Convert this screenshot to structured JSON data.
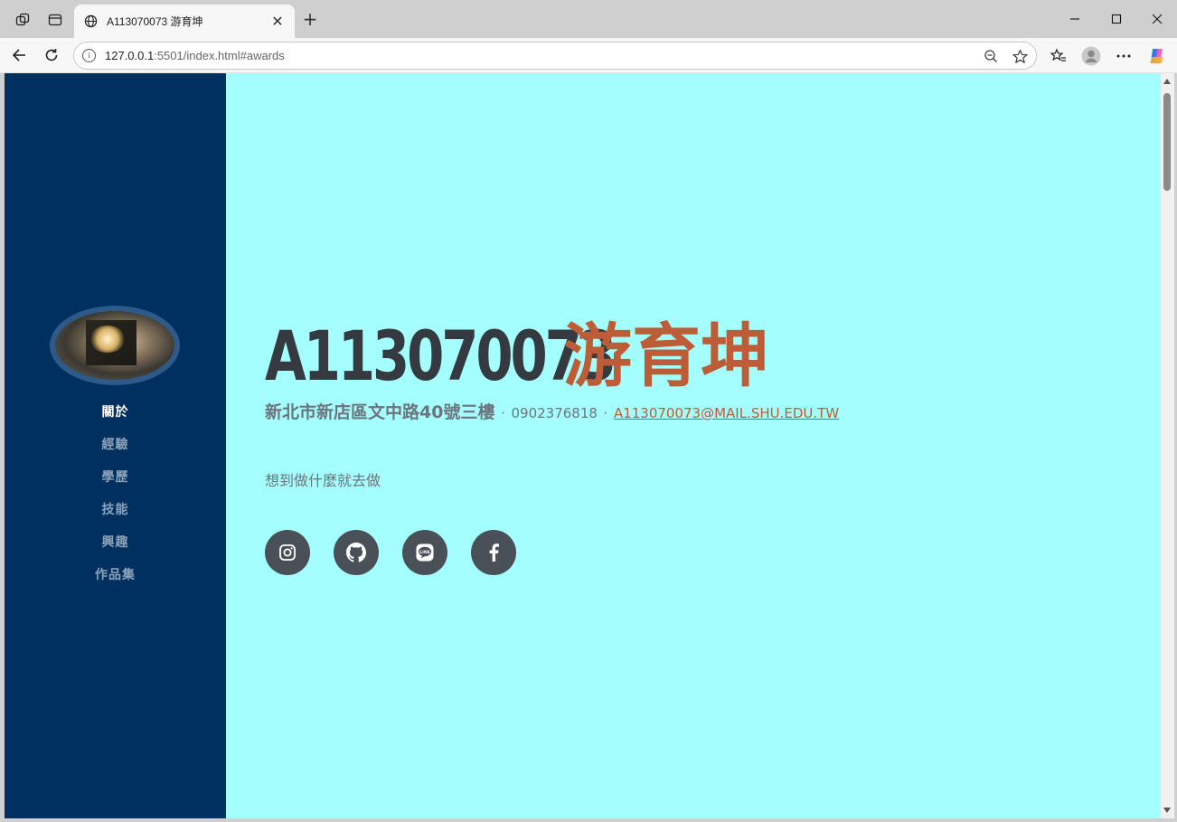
{
  "browser": {
    "tab_title": "A113070073 游育坤",
    "url_host": "127.0.0.1",
    "url_rest": ":5501/index.html#awards"
  },
  "sidebar": {
    "items": [
      {
        "label": "關於"
      },
      {
        "label": "經驗"
      },
      {
        "label": "學歷"
      },
      {
        "label": "技能"
      },
      {
        "label": "興趣"
      },
      {
        "label": "作品集"
      }
    ]
  },
  "profile": {
    "id_number": "A113070073",
    "name": "游育坤",
    "address": "新北市新店區文中路40號三樓",
    "separator": "·",
    "phone": "0902376818",
    "email": "A113070073@MAIL.SHU.EDU.TW",
    "motto": "想到做什麼就去做"
  },
  "social": {
    "icons": [
      "instagram-icon",
      "github-icon",
      "line-icon",
      "facebook-icon"
    ]
  },
  "colors": {
    "sidebar_bg": "#003060",
    "page_bg": "#a5fefe",
    "accent": "#bd5d38",
    "heading": "#343a40",
    "social_bg": "#495057"
  }
}
